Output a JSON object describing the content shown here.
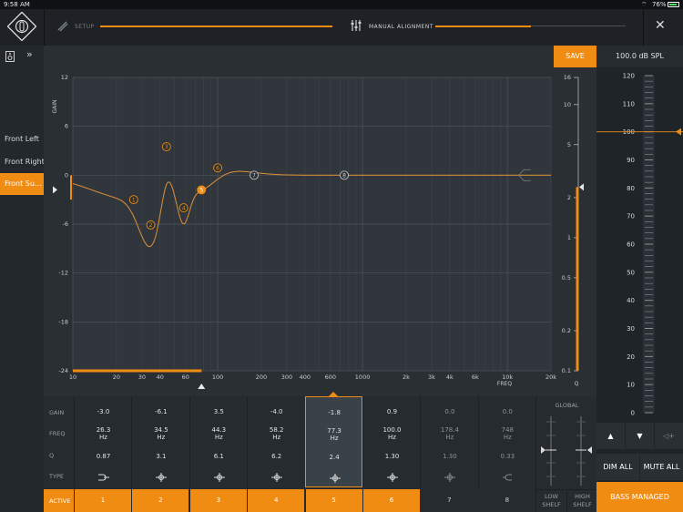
{
  "status": {
    "time": "9:58 AM",
    "battery": "76%"
  },
  "header": {
    "setup_label": "Setup",
    "alignment_label": "Manual Alignment"
  },
  "sources": [
    {
      "label": "Front Left",
      "active": false
    },
    {
      "label": "Front Right",
      "active": false
    },
    {
      "label": "Front Su...",
      "active": true
    }
  ],
  "graph": {
    "save_label": "SAVE",
    "gain_axis_label": "GAIN",
    "freq_axis_label": "FREQ",
    "q_axis_label": "Q",
    "gain_ticks": [
      "12",
      "6",
      "0",
      "-6",
      "-12",
      "-18",
      "-24"
    ],
    "freq_ticks": [
      "10",
      "20",
      "30",
      "40",
      "60",
      "100",
      "200",
      "300",
      "400",
      "600",
      "1000",
      "2k",
      "3k",
      "4k",
      "6k",
      "10k",
      "20k"
    ],
    "q_ticks": [
      "16",
      "10",
      "5",
      "2",
      "1",
      "0.5",
      "0.2",
      "0.1"
    ],
    "markers": [
      "1",
      "2",
      "3",
      "4",
      "5",
      "6",
      "7",
      "8"
    ]
  },
  "table": {
    "row_labels": {
      "gain": "GAIN",
      "freq": "FREQ",
      "q": "Q",
      "type": "TYPE",
      "active": "ACTIVE"
    },
    "unit": "Hz",
    "bands": [
      {
        "n": "1",
        "gain": "-3.0",
        "freq": "26.3",
        "q": "0.87",
        "active": true
      },
      {
        "n": "2",
        "gain": "-6.1",
        "freq": "34.5",
        "q": "3.1",
        "active": true
      },
      {
        "n": "3",
        "gain": "3.5",
        "freq": "44.3",
        "q": "6.1",
        "active": true
      },
      {
        "n": "4",
        "gain": "-4.0",
        "freq": "58.2",
        "q": "6.2",
        "active": true
      },
      {
        "n": "5",
        "gain": "-1.8",
        "freq": "77.3",
        "q": "2.4",
        "active": true
      },
      {
        "n": "6",
        "gain": "0.9",
        "freq": "100.0",
        "q": "1.30",
        "active": true
      },
      {
        "n": "7",
        "gain": "0.0",
        "freq": "178.4",
        "q": "1.30",
        "active": false
      },
      {
        "n": "8",
        "gain": "0.0",
        "freq": "748",
        "q": "0.33",
        "active": false
      }
    ],
    "global_label": "GLOBAL",
    "low_shelf_label": [
      "LOW",
      "SHELF"
    ],
    "high_shelf_label": [
      "HIGH",
      "SHELF"
    ]
  },
  "spl": {
    "readout": "100.0 dB SPL",
    "ticks": [
      "120",
      "110",
      "100",
      "90",
      "80",
      "70",
      "60",
      "50",
      "40",
      "30",
      "20",
      "10",
      "0"
    ],
    "dim_all": "DIM ALL",
    "mute_all": "MUTE ALL",
    "bass_managed": "BASS MANAGED"
  },
  "colors": {
    "accent": "#f08c12",
    "background": "#2a2f34"
  }
}
